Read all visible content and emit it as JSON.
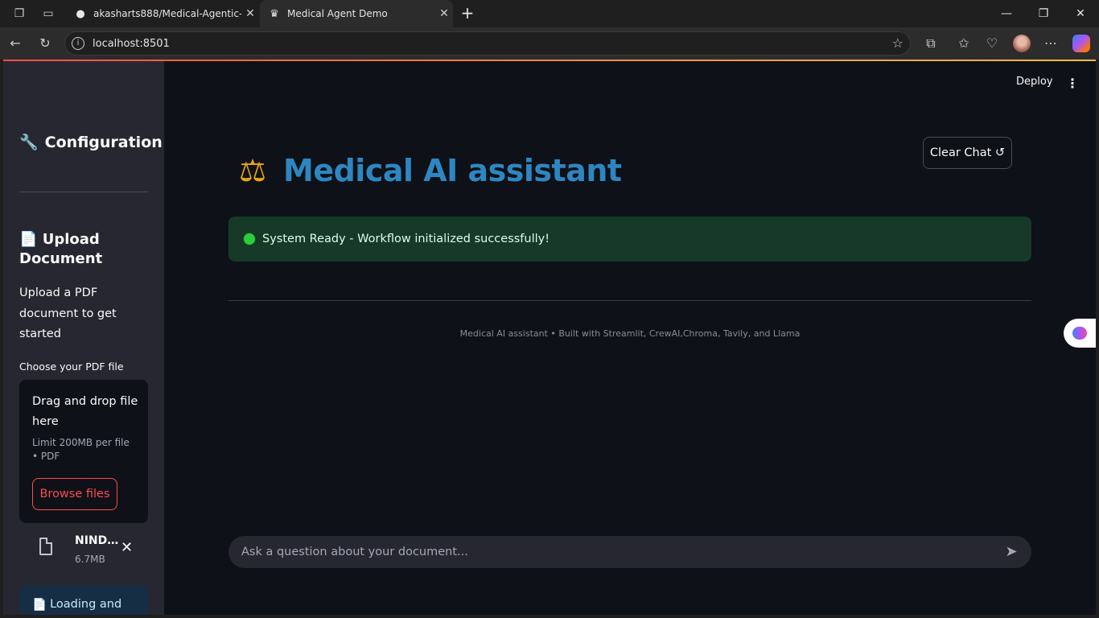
{
  "browser": {
    "tabs": [
      {
        "title": "akasharts888/Medical-Agentic-W",
        "active": false
      },
      {
        "title": "Medical Agent Demo",
        "active": true
      }
    ],
    "url": "localhost:8501"
  },
  "sidebar": {
    "config_title": "Configuration",
    "upload_heading": "Upload Document",
    "upload_text": "Upload a PDF document to get started",
    "file_label": "Choose your PDF file",
    "dropzone": {
      "main_text": "Drag and drop file here",
      "sub_text": "Limit 200MB per file • PDF",
      "browse_label": "Browse files"
    },
    "uploaded_file": {
      "name": "NIND…",
      "size": "6.7MB"
    },
    "status_text": "Loading and"
  },
  "header": {
    "deploy_label": "Deploy"
  },
  "main": {
    "clear_chat_label": "Clear Chat ↺",
    "title": "Medical AI assistant",
    "success_message": "System Ready - Workflow initialized successfully!",
    "footer": "Medical AI assistant • Built with Streamlit, CrewAI,Chroma, Tavily, and Llama",
    "chat_placeholder": "Ask a question about your document..."
  },
  "colors": {
    "background": "#0e1117",
    "sidebar": "#262730",
    "title": "#2e86c1",
    "accent": "#ff4b4b",
    "success_bg": "#173928"
  }
}
